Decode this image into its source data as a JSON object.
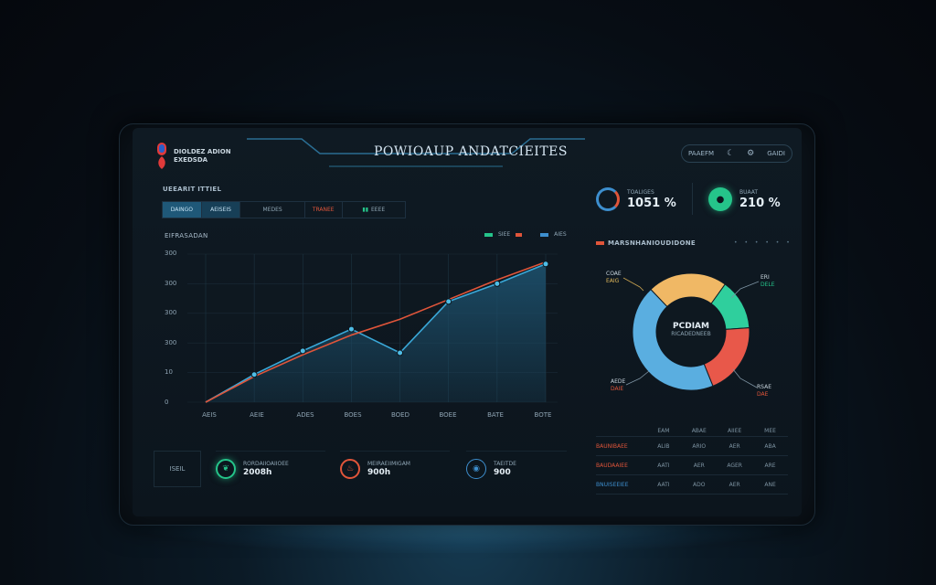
{
  "header": {
    "title": "POWIOAUP ANDATCIEITES",
    "logo_line1": "DIOLDEZ ADION",
    "logo_line2": "EXEDSDA",
    "right_item1": "PAAEFM",
    "right_item2": "GAIDI"
  },
  "left": {
    "section_label": "UEEARIT ITTIEL",
    "tabs": [
      "DAINGO",
      "AEISEIS",
      "MEDES",
      "TRANEE",
      "EEEE"
    ],
    "chart_label": "EIFRASADAN",
    "legend": [
      {
        "label": "SIEE",
        "color": "#25c48a"
      },
      {
        "label": "AIES",
        "color": "#3d8fcf"
      }
    ]
  },
  "chart_data": {
    "type": "area",
    "categories": [
      "AEIS",
      "AEIE",
      "ADES",
      "BOES",
      "BOED",
      "BOEE",
      "BATE",
      "BOTE"
    ],
    "yticks": [
      "0",
      "10",
      "300",
      "300",
      "300",
      "300"
    ],
    "series": [
      {
        "color": "#3aa8d8",
        "values": [
          0,
          14,
          26,
          37,
          25,
          51,
          60,
          70
        ]
      },
      {
        "color": "#e0553a",
        "values": [
          0,
          13,
          24,
          34,
          42,
          52,
          62,
          71
        ]
      }
    ],
    "ylim": [
      0,
      75
    ],
    "colors": {
      "fill": "#1c4d68",
      "stroke": "#3aa8d8",
      "trend": "#e0553a"
    }
  },
  "kpis": [
    {
      "label": "RORDAIIOAIIOEE",
      "value": "2008h",
      "icon_color": "#25c48a",
      "icon": "leaf-icon"
    },
    {
      "label": "MEIRAEIIMIGAM",
      "value": "900h",
      "icon_color": "#e0553a",
      "icon": "flame-icon"
    },
    {
      "label": "TAEITDE",
      "value": "900",
      "icon_color": "#3d8fcf",
      "icon": "drop-icon"
    }
  ],
  "kpi_side_label": "ISEIL",
  "right": {
    "stat1": {
      "label": "TOALIGES",
      "value": "1051 %",
      "color": "#3d8fcf"
    },
    "stat2": {
      "label": "BUAAT",
      "value": "210 %",
      "color": "#25c48a"
    },
    "donut_label": "MARSNHANIOUDIDONE",
    "donut_center_main": "PCDIAM",
    "donut_center_sub": "RICADEDNEEB",
    "donut_notes": [
      {
        "line1": "COAE",
        "line2": "EAIG",
        "color": "#e0b85a"
      },
      {
        "line1": "ERI",
        "line2": "DELE",
        "color": "#25c48a"
      },
      {
        "line1": "AEDE",
        "line2": "DAIE",
        "color": "#e0553a"
      },
      {
        "line1": "RSAE",
        "line2": "DAE",
        "color": "#e0553a"
      }
    ],
    "donut_data": [
      {
        "name": "amber",
        "value": 22,
        "color": "#f0b865"
      },
      {
        "name": "teal",
        "value": 14,
        "color": "#2fcf9d"
      },
      {
        "name": "red",
        "value": 20,
        "color": "#e8584a"
      },
      {
        "name": "blue",
        "value": 44,
        "color": "#5aaee0"
      }
    ],
    "table": {
      "header": [
        "",
        "EAM",
        "ABAE",
        "AIIEE",
        "MEE"
      ],
      "rows": [
        [
          "BAUNIBAEE",
          "ALIB",
          "ARIO",
          "AER",
          "ABA"
        ],
        [
          "BAUDAAIEE",
          "AATI",
          "AER",
          "AGER",
          "ARE"
        ],
        [
          "BNUISEEIEE",
          "AATI",
          "ADO",
          "AER",
          "ANE"
        ]
      ]
    }
  }
}
